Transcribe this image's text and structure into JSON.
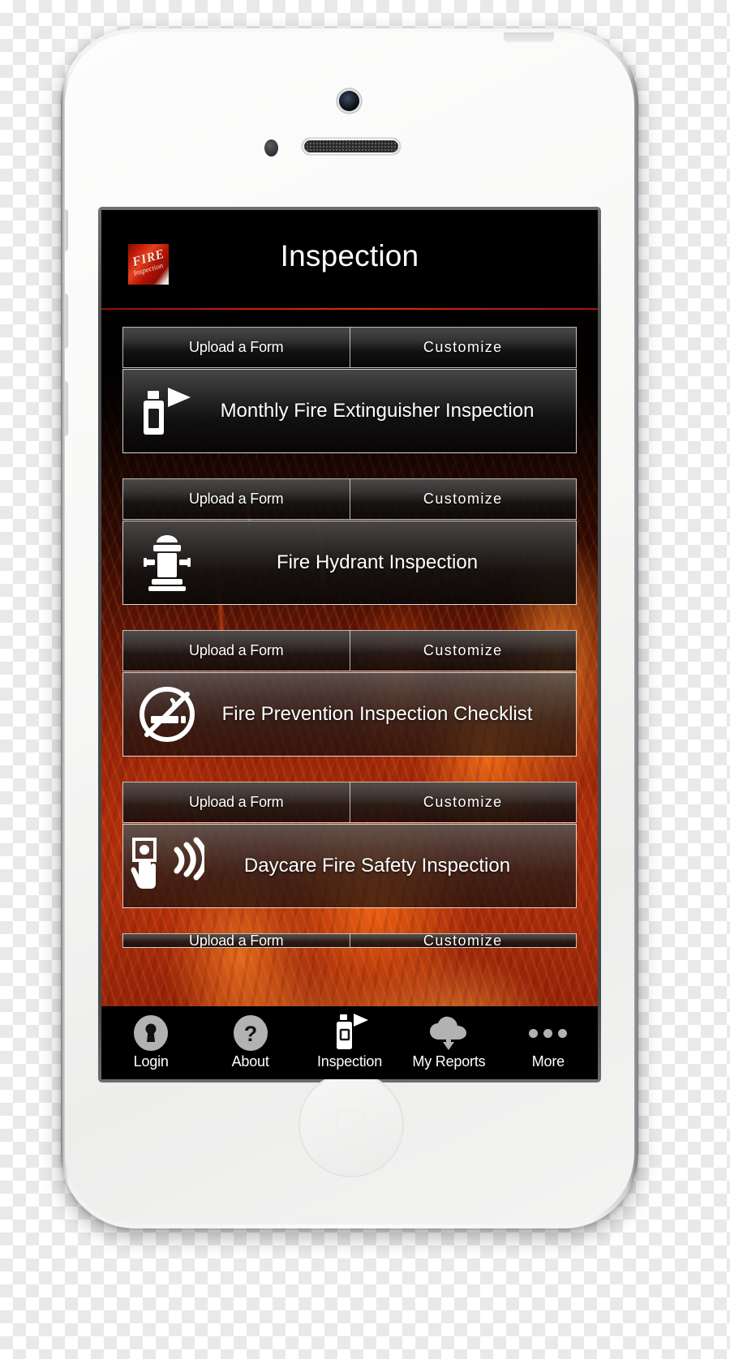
{
  "app": {
    "header": {
      "title": "Inspection",
      "logo_text_primary": "FIRE",
      "logo_text_secondary": "Inspection",
      "accent_color": "#d01c0b",
      "background_color": "#000000"
    },
    "form_groups": [
      {
        "upload_label": "Upload a Form",
        "customize_label": "Customize",
        "form_title": "Monthly Fire Extinguisher Inspection",
        "icon": "fire-extinguisher-icon"
      },
      {
        "upload_label": "Upload a Form",
        "customize_label": "Customize",
        "form_title": "Fire Hydrant Inspection",
        "icon": "fire-hydrant-icon"
      },
      {
        "upload_label": "Upload a Form",
        "customize_label": "Customize",
        "form_title": "Fire Prevention Inspection Checklist",
        "icon": "no-smoking-icon"
      },
      {
        "upload_label": "Upload a Form",
        "customize_label": "Customize",
        "form_title": "Daycare Fire Safety Inspection",
        "icon": "fire-alarm-pull-icon"
      },
      {
        "upload_label": "Upload a Form",
        "customize_label": "Customize",
        "form_title": "",
        "icon": ""
      }
    ],
    "tabs": [
      {
        "label": "Login",
        "icon": "lock-icon",
        "selected": false
      },
      {
        "label": "About",
        "icon": "question-mark-icon",
        "selected": false
      },
      {
        "label": "Inspection",
        "icon": "fire-extinguisher-icon",
        "selected": true
      },
      {
        "label": "My Reports",
        "icon": "cloud-download-icon",
        "selected": false
      },
      {
        "label": "More",
        "icon": "ellipsis-icon",
        "selected": false
      }
    ]
  }
}
